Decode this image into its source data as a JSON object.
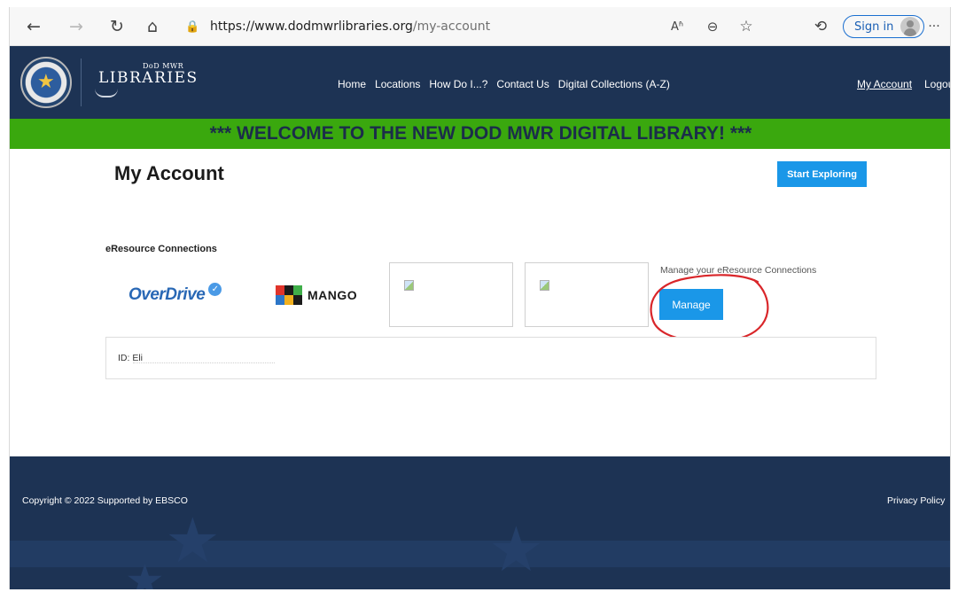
{
  "browser": {
    "url_host": "https://www.dodmwrlibraries.org",
    "url_path": "/my-account",
    "sign_in_label": "Sign in",
    "icons": {
      "back": "back-arrow-icon",
      "forward": "forward-arrow-icon",
      "refresh": "refresh-icon",
      "home": "home-icon",
      "lock": "lock-icon",
      "read_aloud": "read-aloud-icon",
      "zoom": "zoom-icon",
      "favorite": "favorite-icon",
      "history": "history-icon",
      "more": "more-icon"
    },
    "glyphs": {
      "back": "←",
      "forward": "→",
      "refresh": "↻",
      "home": "⌂",
      "lock": "🔒",
      "read_aloud": "Aʱ",
      "zoom": "⊖",
      "favorite": "☆",
      "history": "⟲",
      "more": "···"
    }
  },
  "header": {
    "logo_top": "DoD MWR",
    "logo_main": "LIBRARIES",
    "nav": [
      "Home",
      "Locations",
      "How Do I...?",
      "Contact Us",
      "Digital Collections (A-Z)"
    ],
    "my_account_link": "My Account",
    "logout_link": "Logout"
  },
  "banner": {
    "text": "*** WELCOME TO THE NEW DOD MWR DIGITAL LIBRARY! ***",
    "color": "#3aa80e"
  },
  "main": {
    "title": "My Account",
    "start_exploring_label": "Start Exploring",
    "eresource_heading": "eResource Connections",
    "overdrive_label": "OverDrive",
    "mango_label": "MANGO",
    "manage_text": "Manage your eResource Connections",
    "manage_button": "Manage",
    "id_label": "ID: Eli"
  },
  "footer": {
    "copyright": "Copyright © 2022  Supported by EBSCO",
    "privacy": "Privacy Policy"
  },
  "colors": {
    "navy": "#1d3354",
    "accent_blue": "#1a97e8",
    "annotation_red": "#d9262a"
  }
}
